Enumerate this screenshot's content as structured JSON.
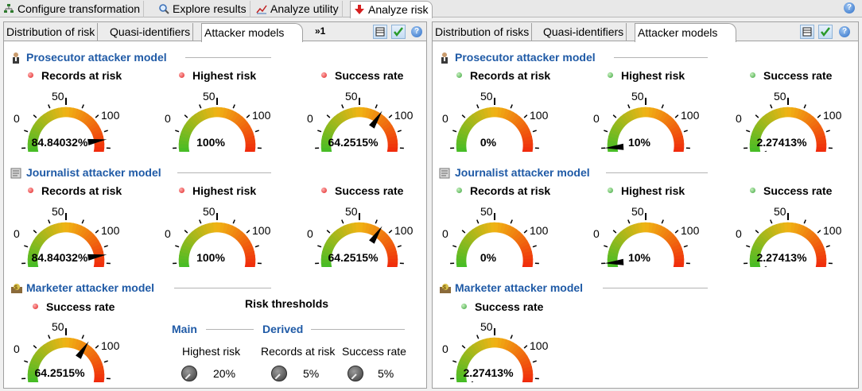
{
  "top_tabs": [
    {
      "label": "Configure transformation",
      "icon": "hierarchy-icon"
    },
    {
      "label": "Explore results",
      "icon": "magnifier-icon"
    },
    {
      "label": "Analyze utility",
      "icon": "chart-line-icon"
    },
    {
      "label": "Analyze risk",
      "icon": "risk-arrow-icon"
    }
  ],
  "left_panel": {
    "tabs": [
      "Distribution of risk",
      "Quasi-identifiers",
      "Attacker models"
    ],
    "overflow": "»1",
    "sections": [
      {
        "title": "Prosecutor attacker model",
        "gauges": [
          {
            "label": "Records at risk",
            "value": 84.84032,
            "text": "84.84032%"
          },
          {
            "label": "Highest risk",
            "value": 100,
            "text": "100%"
          },
          {
            "label": "Success rate",
            "value": 64.2515,
            "text": "64.2515%"
          }
        ]
      },
      {
        "title": "Journalist attacker model",
        "gauges": [
          {
            "label": "Records at risk",
            "value": 84.84032,
            "text": "84.84032%"
          },
          {
            "label": "Highest risk",
            "value": 100,
            "text": "100%"
          },
          {
            "label": "Success rate",
            "value": 64.2515,
            "text": "64.2515%"
          }
        ]
      },
      {
        "title": "Marketer attacker model",
        "gauges": [
          {
            "label": "Success rate",
            "value": 64.2515,
            "text": "64.2515%"
          }
        ]
      }
    ],
    "thresholds": {
      "title": "Risk thresholds",
      "main": "Main",
      "derived": "Derived",
      "items": [
        {
          "label": "Highest risk",
          "value": "20%"
        },
        {
          "label": "Records at risk",
          "value": "5%"
        },
        {
          "label": "Success rate",
          "value": "5%"
        }
      ]
    }
  },
  "right_panel": {
    "tabs": [
      "Distribution of risks",
      "Quasi-identifiers",
      "Attacker models"
    ],
    "sections": [
      {
        "title": "Prosecutor attacker model",
        "gauges": [
          {
            "label": "Records at risk",
            "value": 0,
            "text": "0%"
          },
          {
            "label": "Highest risk",
            "value": 10,
            "text": "10%"
          },
          {
            "label": "Success rate",
            "value": 2.27413,
            "text": "2.27413%"
          }
        ]
      },
      {
        "title": "Journalist attacker model",
        "gauges": [
          {
            "label": "Records at risk",
            "value": 0,
            "text": "0%"
          },
          {
            "label": "Highest risk",
            "value": 10,
            "text": "10%"
          },
          {
            "label": "Success rate",
            "value": 2.27413,
            "text": "2.27413%"
          }
        ]
      },
      {
        "title": "Marketer attacker model",
        "gauges": [
          {
            "label": "Success rate",
            "value": 2.27413,
            "text": "2.27413%"
          }
        ]
      }
    ]
  },
  "gauge_scale": {
    "min_label": "0",
    "mid_label": "50",
    "max_label": "100",
    "min": 0,
    "max": 100
  },
  "colors": {
    "accent": "#1f5aa6",
    "risk_dot": "#e02020",
    "ok_dot": "#3aa43a"
  }
}
